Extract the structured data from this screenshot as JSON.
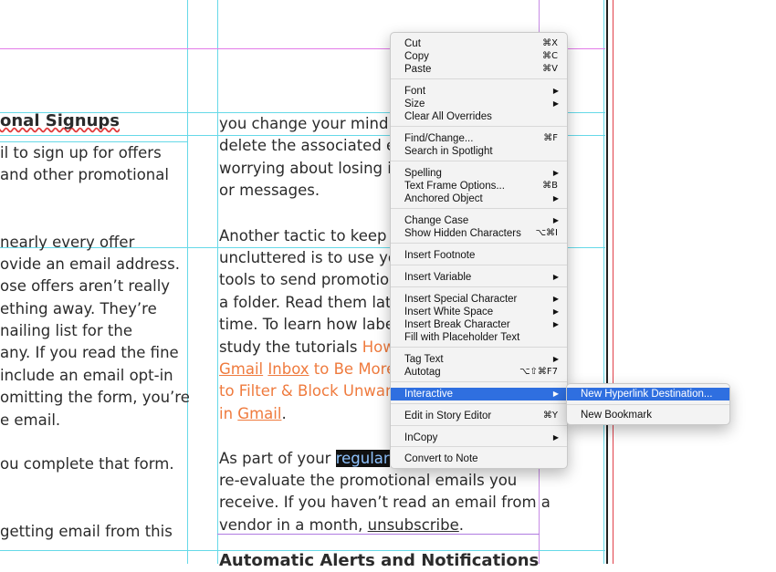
{
  "document": {
    "left_col": {
      "heading": "onal Signups",
      "lines": [
        "il to sign up for offers",
        "and other promotional",
        " nearly every offer",
        "ovide an email address.",
        "ose offers aren’t really",
        "ething away. They’re",
        "nailing list for the",
        "any. If you read the fine",
        "include an email opt-in",
        "omitting the form, you’re",
        "e email.",
        "ou complete that form.",
        " getting email from this"
      ]
    },
    "right_col": {
      "p1": [
        "you change your mind a",
        "delete the associated e",
        "worrying about losing i",
        "or messages."
      ],
      "p2": [
        "Another tactic to keep y",
        "uncluttered is to use yo",
        "tools to send promotio",
        "a folder. Read them late",
        "time. To learn how labe"
      ],
      "p2_study": "study the tutorials ",
      "p2_link1": "How",
      "p2_gmail1": "Gmail",
      "p2_inbox": "Inbox",
      "p2_link2": " to Be More",
      "p2_link3": "to Filter & Block Unwan",
      "p2_in": "in ",
      "p2_gmail2": "Gmail",
      "p2_period": ".",
      "p3_a": "As part of your ",
      "p3_sel": "regular ",
      "p3": [
        "re-evaluate the promotional emails you",
        "receive. If you haven’t read an email from a"
      ],
      "p3_vendor": "vendor in a month, ",
      "p3_unsub": "unsubscribe",
      "p3_end": ".",
      "next_heading": "Automatic Alerts and Notifications"
    }
  },
  "context_menu": {
    "items": [
      {
        "label": "Cut",
        "shortcut": "⌘X"
      },
      {
        "label": "Copy",
        "shortcut": "⌘C"
      },
      {
        "label": "Paste",
        "shortcut": "⌘V"
      },
      {
        "label": "Font",
        "submenu": true
      },
      {
        "label": "Size",
        "submenu": true
      },
      {
        "label": "Clear All Overrides"
      },
      {
        "label": "Find/Change...",
        "shortcut": "⌘F"
      },
      {
        "label": "Search in Spotlight"
      },
      {
        "label": "Spelling",
        "submenu": true
      },
      {
        "label": "Text Frame Options...",
        "shortcut": "⌘B"
      },
      {
        "label": "Anchored Object",
        "submenu": true
      },
      {
        "label": "Change Case",
        "submenu": true
      },
      {
        "label": "Show Hidden Characters",
        "shortcut": "⌥⌘I"
      },
      {
        "label": "Insert Footnote"
      },
      {
        "label": "Insert Variable",
        "submenu": true
      },
      {
        "label": "Insert Special Character",
        "submenu": true
      },
      {
        "label": "Insert White Space",
        "submenu": true
      },
      {
        "label": "Insert Break Character",
        "submenu": true
      },
      {
        "label": "Fill with Placeholder Text"
      },
      {
        "label": "Tag Text",
        "submenu": true
      },
      {
        "label": "Autotag",
        "shortcut": "⌥⇧⌘F7"
      },
      {
        "label": "Interactive",
        "submenu": true,
        "highlighted": true
      },
      {
        "label": "Edit in Story Editor",
        "shortcut": "⌘Y"
      },
      {
        "label": "InCopy",
        "submenu": true
      },
      {
        "label": "Convert to Note"
      }
    ],
    "arrow_glyph": "▶"
  },
  "submenu": {
    "items": [
      {
        "label": "New Hyperlink Destination...",
        "highlighted": true
      },
      {
        "label": "New Bookmark"
      }
    ]
  },
  "colors": {
    "guide": "#66d9e8",
    "margin": "#e27be8",
    "link": "#ef7b3e",
    "highlight": "#2f6fe0"
  }
}
